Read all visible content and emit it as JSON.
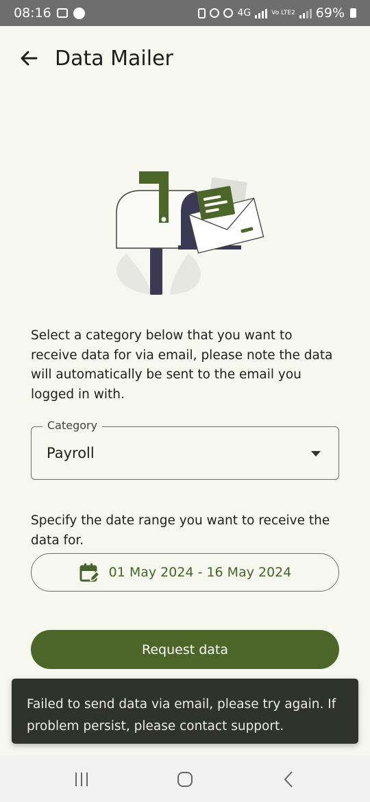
{
  "status_bar": {
    "time": "08:16",
    "network": "4G",
    "volte": "Vo LTE2",
    "battery": "69%"
  },
  "app_bar": {
    "title": "Data Mailer",
    "back_icon": "arrow-back-icon"
  },
  "illustration": {
    "icon": "mailbox-illustration",
    "colors": {
      "green": "#4b6628",
      "navy": "#3b3a55",
      "light": "#e4e5df"
    }
  },
  "main": {
    "description": "Select a category below that you want to receive data for via email, please note the data will automatically be sent to the email you logged in with.",
    "category_field": {
      "label": "Category",
      "value": "Payroll",
      "icon": "dropdown-arrow-icon"
    },
    "date_description": "Specify the date range you want to receive the data for.",
    "date_range": {
      "value": "01 May 2024 - 16 May 2024",
      "icon": "calendar-edit-icon"
    },
    "request_button": "Request data"
  },
  "snackbar": {
    "message": "Failed to send data via email, please try again. If problem persist, please contact support."
  },
  "nav_bar": {
    "recents_icon": "recents-icon",
    "home_icon": "home-icon",
    "back_icon": "back-icon"
  },
  "colors": {
    "accent": "#4b6628",
    "background": "#f6f7ee",
    "snackbar": "#30322c",
    "accent_text": "#47622a"
  }
}
